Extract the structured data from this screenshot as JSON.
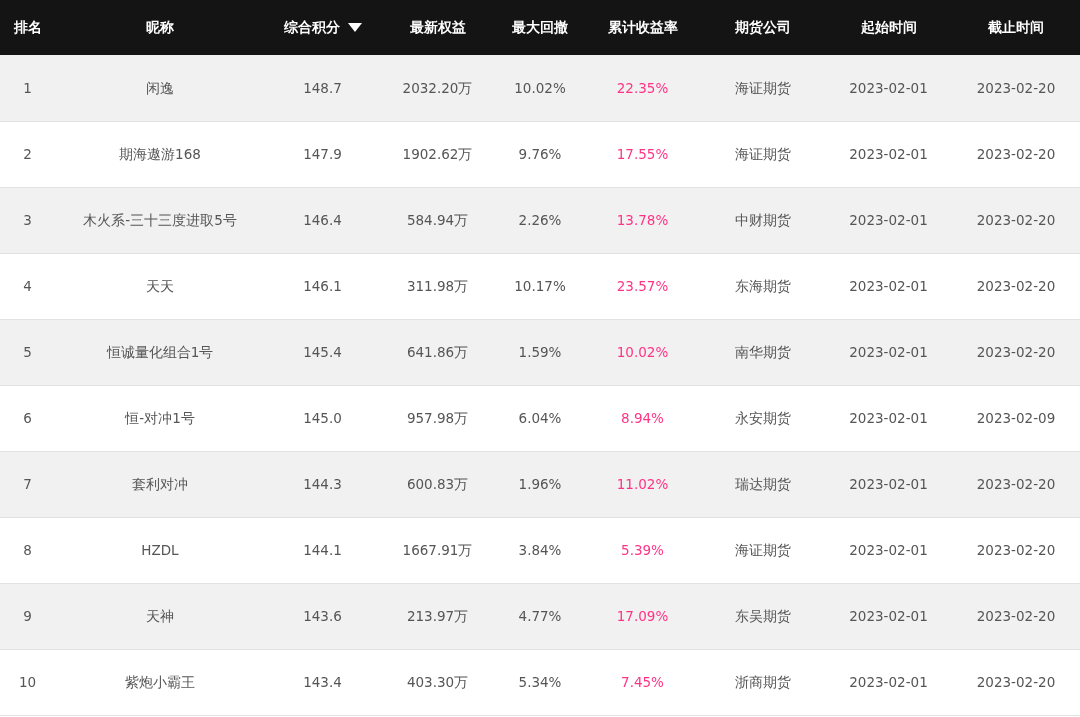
{
  "table": {
    "columns": [
      {
        "label": "排名",
        "sorted": false
      },
      {
        "label": "昵称",
        "sorted": false
      },
      {
        "label": "综合积分",
        "sorted": true
      },
      {
        "label": "最新权益",
        "sorted": false
      },
      {
        "label": "最大回撤",
        "sorted": false
      },
      {
        "label": "累计收益率",
        "sorted": false
      },
      {
        "label": "期货公司",
        "sorted": false
      },
      {
        "label": "起始时间",
        "sorted": false
      },
      {
        "label": "截止时间",
        "sorted": false
      }
    ],
    "rows": [
      [
        "1",
        "闲逸",
        "148.7",
        "2032.20万",
        "10.02%",
        "22.35%",
        "海证期货",
        "2023-02-01",
        "2023-02-20"
      ],
      [
        "2",
        "期海遨游168",
        "147.9",
        "1902.62万",
        "9.76%",
        "17.55%",
        "海证期货",
        "2023-02-01",
        "2023-02-20"
      ],
      [
        "3",
        "木火系-三十三度进取5号",
        "146.4",
        "584.94万",
        "2.26%",
        "13.78%",
        "中财期货",
        "2023-02-01",
        "2023-02-20"
      ],
      [
        "4",
        "天天",
        "146.1",
        "311.98万",
        "10.17%",
        "23.57%",
        "东海期货",
        "2023-02-01",
        "2023-02-20"
      ],
      [
        "5",
        "恒诚量化组合1号",
        "145.4",
        "641.86万",
        "1.59%",
        "10.02%",
        "南华期货",
        "2023-02-01",
        "2023-02-20"
      ],
      [
        "6",
        "恒-对冲1号",
        "145.0",
        "957.98万",
        "6.04%",
        "8.94%",
        "永安期货",
        "2023-02-01",
        "2023-02-09"
      ],
      [
        "7",
        "套利对冲",
        "144.3",
        "600.83万",
        "1.96%",
        "11.02%",
        "瑞达期货",
        "2023-02-01",
        "2023-02-20"
      ],
      [
        "8",
        "HZDL",
        "144.1",
        "1667.91万",
        "3.84%",
        "5.39%",
        "海证期货",
        "2023-02-01",
        "2023-02-20"
      ],
      [
        "9",
        "天神",
        "143.6",
        "213.97万",
        "4.77%",
        "17.09%",
        "东吴期货",
        "2023-02-01",
        "2023-02-20"
      ],
      [
        "10",
        "紫炮小霸王",
        "143.4",
        "403.30万",
        "5.34%",
        "7.45%",
        "浙商期货",
        "2023-02-01",
        "2023-02-20"
      ]
    ]
  }
}
